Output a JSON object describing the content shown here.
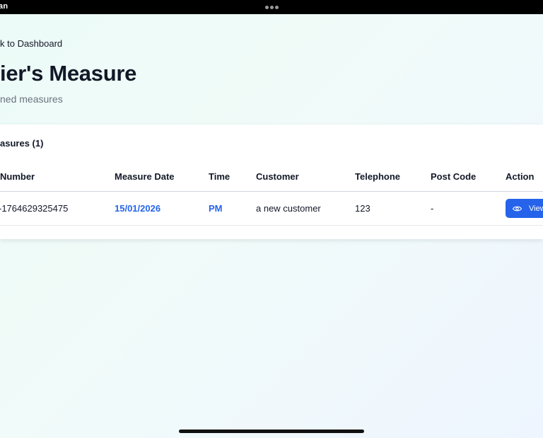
{
  "status_bar": {
    "left_text": "an"
  },
  "header": {
    "back_link": "k to Dashboard",
    "title": "ier's Measure",
    "subtitle": "ned measures"
  },
  "card": {
    "title": "asures (1)",
    "columns": [
      "Number",
      "Measure Date",
      "Time",
      "Customer",
      "Telephone",
      "Post Code",
      "Action"
    ],
    "rows": [
      {
        "number": "-1764629325475",
        "measure_date": "15/01/2026",
        "time": "PM",
        "customer": "a new customer",
        "telephone": "123",
        "post_code": "-",
        "action_label": "View",
        "action_icon": "eye-icon"
      }
    ]
  },
  "colors": {
    "accent": "#2563eb",
    "text": "#111827",
    "muted": "#6b7280"
  }
}
